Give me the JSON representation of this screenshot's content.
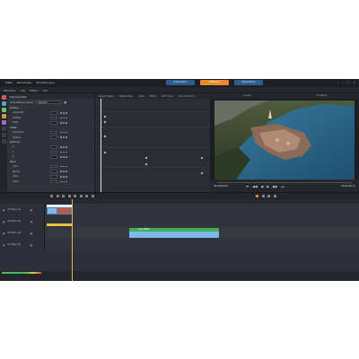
{
  "menu": [
    "Datei",
    "Bearbeiten",
    "Einstellungen"
  ],
  "mode_tabs": [
    "Importieren",
    "Editieren",
    "Exportieren"
  ],
  "win_controls": [
    "?",
    "–",
    "□",
    "✕"
  ],
  "library_tabs": [
    "Bibliothek",
    "Titel",
    "Effekte",
    "Text"
  ],
  "panel": {
    "title": "Eigenschaften",
    "preset_label": "Voreinstellung wählen",
    "preset_value": "Standard",
    "sections": [
      {
        "name": "Position",
        "props": [
          "Horizontal",
          "Vertikal",
          "Tiefe"
        ]
      },
      {
        "name": "Größe",
        "props": [
          "Horizontal",
          "Vertikal"
        ]
      },
      {
        "name": "Drehung",
        "props": [
          "X",
          "Y",
          "Z"
        ]
      },
      {
        "name": "Rand",
        "props": [
          "Links",
          "Rechts",
          "Oben",
          "Unten"
        ]
      }
    ]
  },
  "keyframe_headers": [
    "Eigenschaften",
    "Master-Video",
    "Farbe",
    "Effekt",
    "360°-Video",
    "Pan und Zoom"
  ],
  "preview": {
    "tabs": [
      "Quelle",
      "Timeline"
    ],
    "time_left": "00:00:00.00",
    "time_right": "00:00:09.12",
    "controls": [
      "⏮",
      "◀◀",
      "◀",
      "▶",
      "▶▶",
      "⏭"
    ]
  },
  "tracks": [
    {
      "label": "A/V Spur (1)"
    },
    {
      "label": "A/V Spur (2)"
    },
    {
      "label": "A/V Spur (3)"
    },
    {
      "label": "A/V Spur (4)"
    }
  ],
  "clips": [
    {
      "name": "Video.mp4",
      "color": "#7fb7e8"
    },
    {
      "name": "Audio",
      "color": "#e6c23e"
    },
    {
      "name": "Spur-Effekt",
      "color": "#3fae56"
    }
  ]
}
